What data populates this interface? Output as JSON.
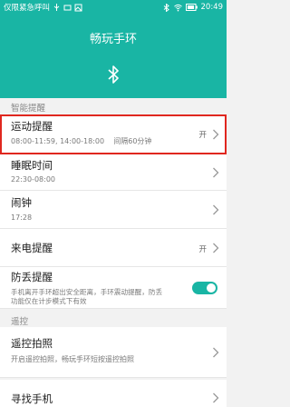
{
  "status_bar": {
    "carrier": "仅限紧急呼叫",
    "time": "20:49",
    "icons": [
      "usb-icon",
      "tag-icon",
      "image-icon",
      "bluetooth-icon",
      "wifi-icon",
      "battery-icon"
    ]
  },
  "header": {
    "title": "畅玩手环",
    "bluetooth_icon": "bluetooth-icon"
  },
  "sections": {
    "smart_reminders": "智能提醒",
    "remote": "遥控"
  },
  "rows": [
    {
      "title": "运动提醒",
      "subtitle": "08:00-11:59, 14:00-18:00    间隔60分钟",
      "value": "开",
      "highlighted": true
    },
    {
      "title": "睡眠时间",
      "subtitle": "22:30-08:00",
      "value": ""
    },
    {
      "title": "闹钟",
      "subtitle": "17:28",
      "value": ""
    },
    {
      "title": "来电提醒",
      "subtitle": "",
      "value": "开"
    },
    {
      "title": "防丢提醒",
      "subtitle_line1": "手机离开手环超出安全距离，手环震动提醒，防丢",
      "subtitle_line2": "功能仅在计步模式下有效",
      "toggle_on": true
    },
    {
      "title": "遥控拍照",
      "subtitle": "开启遥控拍照，畅玩手环短按遥控拍照"
    },
    {
      "title": "寻找手机"
    }
  ],
  "colors": {
    "accent": "#19b5a4",
    "highlight": "#e0271f"
  }
}
